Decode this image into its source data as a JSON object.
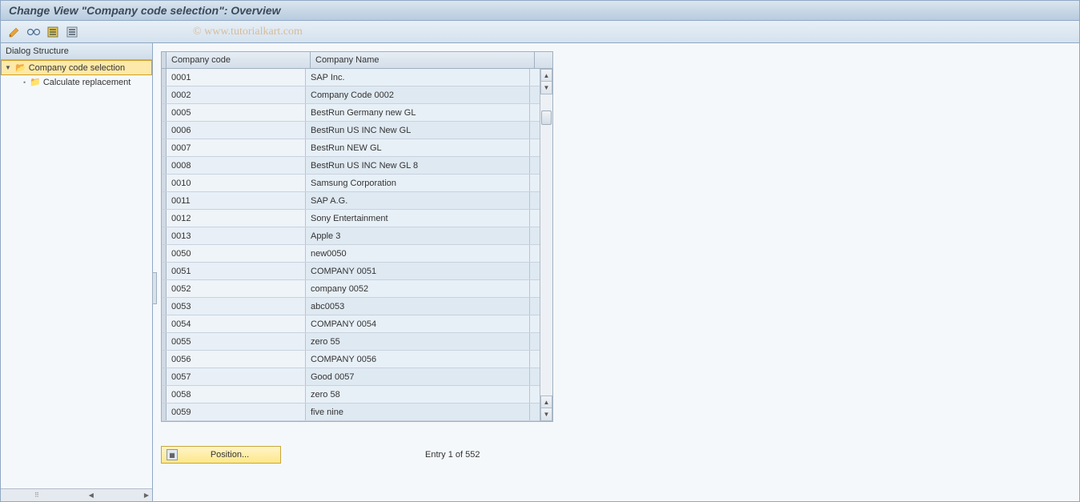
{
  "title": "Change View \"Company code selection\": Overview",
  "watermark": "© www.tutorialkart.com",
  "dialog_structure": {
    "header": "Dialog Structure",
    "items": [
      {
        "label": "Company code selection",
        "selected": true,
        "open": true,
        "indent": 0
      },
      {
        "label": "Calculate replacement",
        "selected": false,
        "open": false,
        "indent": 1
      }
    ]
  },
  "table": {
    "columns": {
      "code": "Company code",
      "name": "Company Name"
    },
    "rows": [
      {
        "code": "0001",
        "name": "SAP Inc."
      },
      {
        "code": "0002",
        "name": "Company Code 0002"
      },
      {
        "code": "0005",
        "name": "BestRun Germany new GL"
      },
      {
        "code": "0006",
        "name": "BestRun US INC New GL"
      },
      {
        "code": "0007",
        "name": "BestRun NEW GL"
      },
      {
        "code": "0008",
        "name": "BestRun US INC New GL 8"
      },
      {
        "code": "0010",
        "name": "Samsung Corporation"
      },
      {
        "code": "0011",
        "name": "SAP A.G."
      },
      {
        "code": "0012",
        "name": "Sony Entertainment"
      },
      {
        "code": "0013",
        "name": "Apple 3"
      },
      {
        "code": "0050",
        "name": "new0050"
      },
      {
        "code": "0051",
        "name": "COMPANY 0051"
      },
      {
        "code": "0052",
        "name": "company 0052"
      },
      {
        "code": "0053",
        "name": "abc0053"
      },
      {
        "code": "0054",
        "name": "COMPANY 0054"
      },
      {
        "code": "0055",
        "name": "zero 55"
      },
      {
        "code": "0056",
        "name": "COMPANY 0056"
      },
      {
        "code": "0057",
        "name": "Good 0057"
      },
      {
        "code": "0058",
        "name": "zero 58"
      },
      {
        "code": "0059",
        "name": "five nine"
      }
    ]
  },
  "footer": {
    "position_label": "Position...",
    "entry_text": "Entry 1 of 552"
  }
}
